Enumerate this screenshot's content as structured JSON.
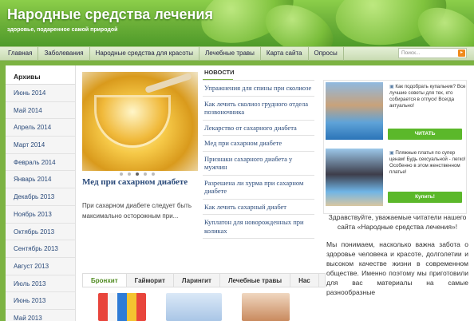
{
  "header": {
    "title": "Народные средства лечения",
    "subtitle": "здоровье, подаренное самой природой"
  },
  "nav": {
    "items": [
      "Главная",
      "Заболевания",
      "Народные средства для красоты",
      "Лечебные травы",
      "Карта сайта",
      "Опросы"
    ]
  },
  "search": {
    "placeholder": "Поиск...",
    "button": "▸"
  },
  "sidebar": {
    "title": "Архивы",
    "items": [
      "Июнь 2014",
      "Май 2014",
      "Апрель 2014",
      "Март 2014",
      "Февраль 2014",
      "Январь 2014",
      "Декабрь 2013",
      "Ноябрь 2013",
      "Октябрь 2013",
      "Сентябрь 2013",
      "Август 2013",
      "Июль 2013",
      "Июнь 2013",
      "Май 2013"
    ]
  },
  "feature": {
    "title": "Мед при сахарном диабете",
    "text": "При сахарном диабете следует быть максимально осторожным при..."
  },
  "news": {
    "heading": "НОВОСТИ",
    "items": [
      "Упражнения для спины при сколиозе",
      "Как лечить сколиоз грудного отдела позвоночника",
      "Лекарство от сахарного диабета",
      "Мед при сахарном диабете",
      "Признаки сахарного диабета у мужчин",
      "Разрешена ли хурма при сахарном диабете",
      "Как лечить сахарный диабет",
      "Куплатон для новорожденных при коликах"
    ]
  },
  "tabs": [
    "Бронхит",
    "Гайморит",
    "Ларингит",
    "Лечебные травы",
    "Нас"
  ],
  "ads": [
    {
      "text": "Как подобрать купальник? Все лучшие советы для тех, кто собирается в отпуск! Всегда актуально!",
      "button": "ЧИТАТЬ"
    },
    {
      "text": "Пляжные платья по супер ценам! Будь сексуальной - легко! Особенно в этом женственном платье!",
      "button": "Купить!"
    }
  ],
  "intro": {
    "greeting": "Здравствуйте, уважаемые читатели нашего сайта «Народные средства лечения»!",
    "body": "Мы понимаем, насколько важна забота о здоровье человека и красоте, долголетии и высоком качестве жизни в современном обществе. Именно поэтому мы приготовили для вас материалы на самые разнообразные"
  }
}
